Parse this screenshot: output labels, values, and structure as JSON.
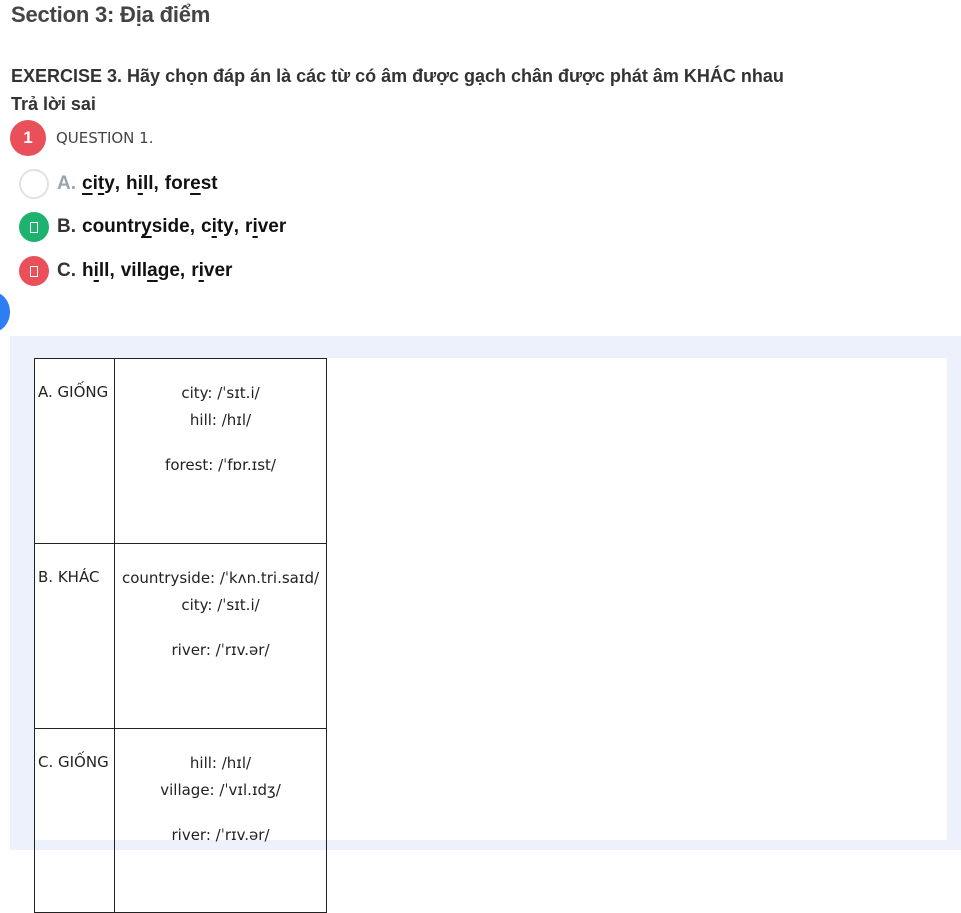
{
  "section": {
    "title": "Section 3: Địa điểm"
  },
  "exercise": {
    "instruction": "EXERCISE 3. Hãy chọn đáp án là các từ có âm được gạch chân được phát âm KHÁC nhau",
    "result": "Trả lời sai"
  },
  "question": {
    "number": "1",
    "label": "QUESTION 1."
  },
  "options": [
    {
      "letter": "A.",
      "status": "unselected",
      "words": [
        "city",
        "hill",
        "forest"
      ]
    },
    {
      "letter": "B.",
      "status": "correct",
      "words": [
        "countryside",
        "city",
        "river"
      ]
    },
    {
      "letter": "C.",
      "status": "wrong",
      "words": [
        "hill",
        "village",
        "river"
      ]
    }
  ],
  "explanation_table": [
    {
      "label": "A. GIỐNG",
      "lines": [
        "city: /ˈsɪt.i/",
        "hill: /hɪl/",
        "forest: /ˈfɒr.ɪst/"
      ]
    },
    {
      "label": "B. KHÁC",
      "lines": [
        "countryside: /ˈkʌn.tri.saɪd/",
        "city: /ˈsɪt.i/",
        "river: /ˈrɪv.ər/"
      ]
    },
    {
      "label": "C. GIỐNG",
      "lines": [
        "hill: /hɪl/",
        "village: /ˈvɪl.ɪdʒ/",
        "river: /ˈrɪv.ər/"
      ]
    }
  ],
  "colors": {
    "correct": "#1db36e",
    "wrong": "#e9505a",
    "panel_bg": "#edf1fb",
    "side_tab": "#2d7df6"
  }
}
